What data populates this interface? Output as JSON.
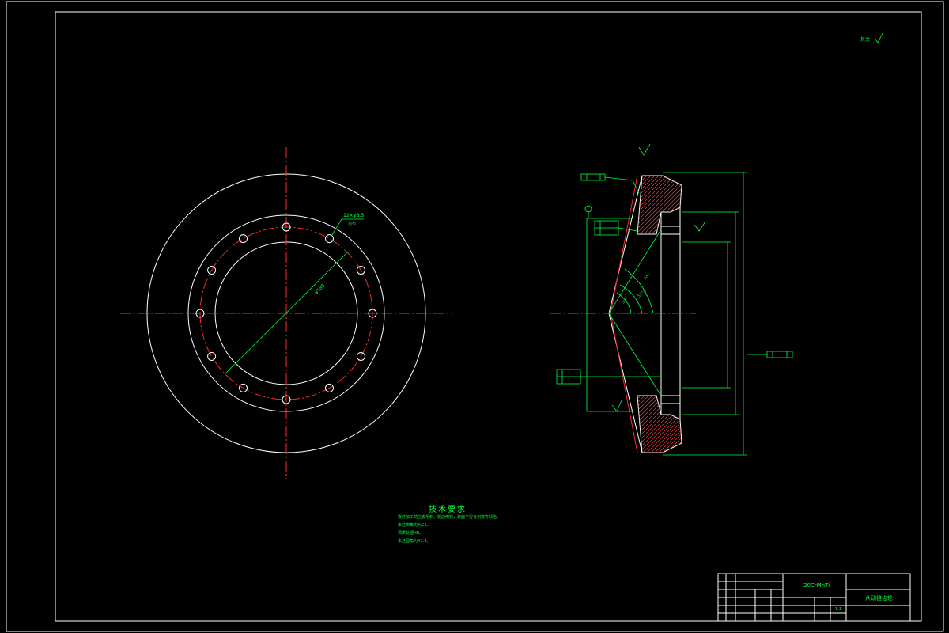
{
  "drawing": {
    "surface_finish_note": "其余",
    "hole_pattern_label": "12×φ8.5",
    "hole_pattern_sub": "均布",
    "pitch_circle_label": "φ188",
    "colors": {
      "background": "#000000",
      "outline": "#ffffff",
      "centerline": "#ff2a2a",
      "dimension": "#00ff3c"
    }
  },
  "section": {
    "angle_labels": [
      "70°",
      "57°8′",
      "33°"
    ],
    "tolerance_frames": [
      {
        "symbol": "⊥",
        "value": "0.02",
        "datum": "A"
      },
      {
        "symbol": "⊥",
        "value": "0.02",
        "datum": "A"
      },
      {
        "symbol": "◎",
        "value": "0.02",
        "datum": "A"
      },
      {
        "symbol": "⊥",
        "value": "0.02",
        "datum": "A"
      }
    ]
  },
  "technical_requirements": {
    "title": "技术要求",
    "items": [
      "零件加工前应去毛刺、锐边倒钝，表面不得有划痕等缺陷。",
      "未注倒角均为C1。",
      "调质处理HB。",
      "未注圆角为R1.5。"
    ]
  },
  "title_block": {
    "material": "20CrMnTi",
    "part_name": "从动锥齿轮",
    "scale": "1:1"
  }
}
